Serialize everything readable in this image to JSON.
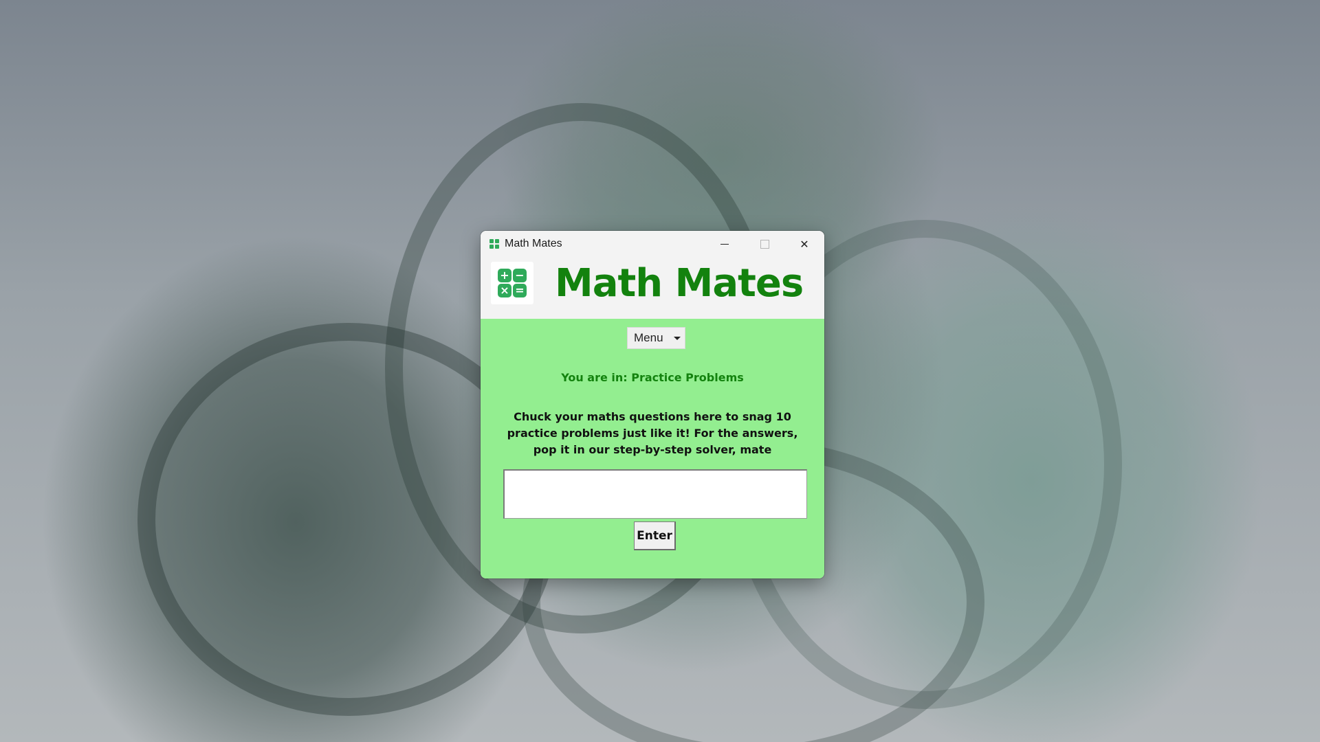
{
  "window": {
    "title": "Math Mates",
    "icon": "app-grid-icon",
    "controls": {
      "minimize_icon": "minimize-icon",
      "maximize_icon": "maximize-icon",
      "close_icon": "close-icon",
      "close_glyph": "✕"
    }
  },
  "header": {
    "logo_icon": "calculator-icon",
    "logo_symbols": [
      "+",
      "−",
      "×",
      "="
    ],
    "title": "Math Mates"
  },
  "menu": {
    "label": "Menu",
    "arrow_icon": "chevron-down-icon"
  },
  "status": {
    "location_text": "You are in: Practice Problems"
  },
  "instructions": {
    "text": "Chuck your maths questions here to snag 10 practice problems just like it! For the answers, pop it in our step-by-step solver, mate"
  },
  "question_input": {
    "value": "",
    "placeholder": ""
  },
  "enter_button": {
    "label": "Enter"
  },
  "colors": {
    "content_background": "#93ee90",
    "title_green": "#13820e",
    "logo_green": "#2faa5a",
    "chrome_background": "#f3f3f3"
  }
}
